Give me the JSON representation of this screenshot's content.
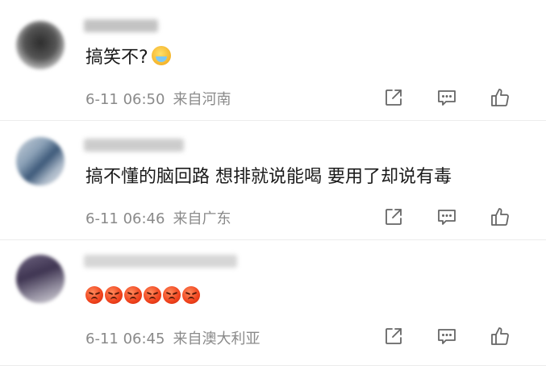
{
  "comments": [
    {
      "text": "搞笑不?",
      "time": "6-11 06:50",
      "source": "来自河南",
      "emoji": "laugh-cry-icon"
    },
    {
      "text": "搞不懂的脑回路 想排就说能喝 要用了却说有毒",
      "time": "6-11 06:46",
      "source": "来自广东"
    },
    {
      "emoji_count": 6,
      "emoji": "angry-face-icon",
      "time": "6-11 06:45",
      "source": "来自澳大利亚"
    }
  ]
}
